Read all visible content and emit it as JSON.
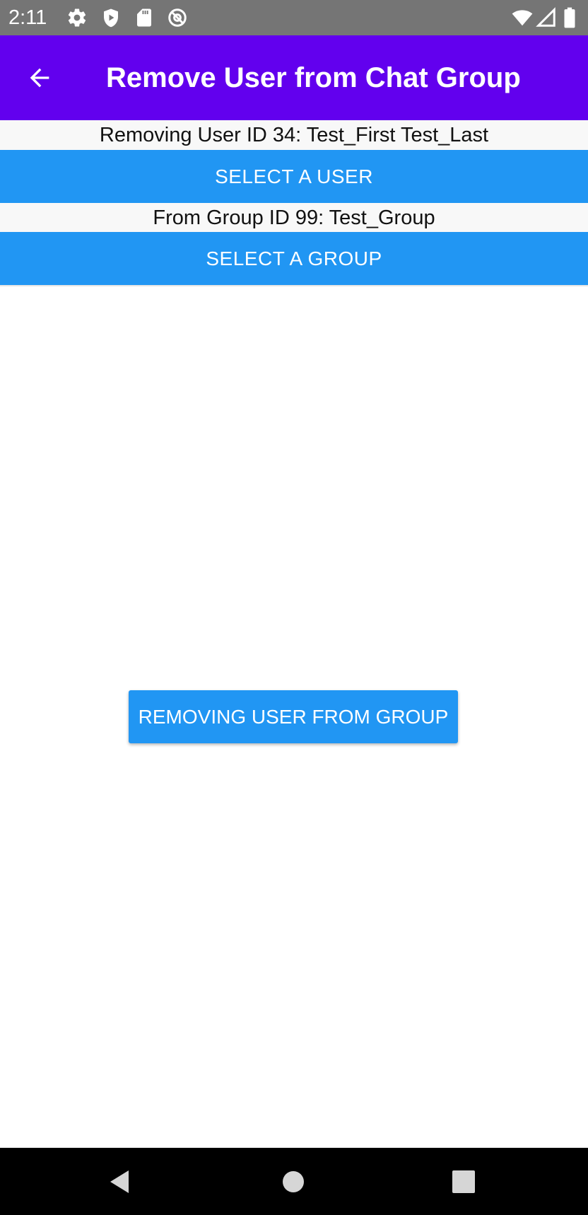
{
  "status_bar": {
    "time": "2:11",
    "icons": [
      "gear-icon",
      "shield-icon",
      "sd-card-icon",
      "at-sign-icon",
      "wifi-icon",
      "signal-icon",
      "battery-icon"
    ]
  },
  "app_bar": {
    "title": "Remove User from Chat Group",
    "back_icon": "arrow-left-icon",
    "color": "#6200ee"
  },
  "content": {
    "user_label": "Removing User ID 34: Test_First Test_Last",
    "select_user_button": "SELECT A USER",
    "group_label": "From Group ID 99: Test_Group",
    "select_group_button": "SELECT A GROUP",
    "action_button": "REMOVING USER FROM GROUP",
    "button_color": "#2196f3"
  },
  "nav_bar": {
    "icons": [
      "back-triangle-icon",
      "home-circle-icon",
      "recents-square-icon"
    ]
  }
}
